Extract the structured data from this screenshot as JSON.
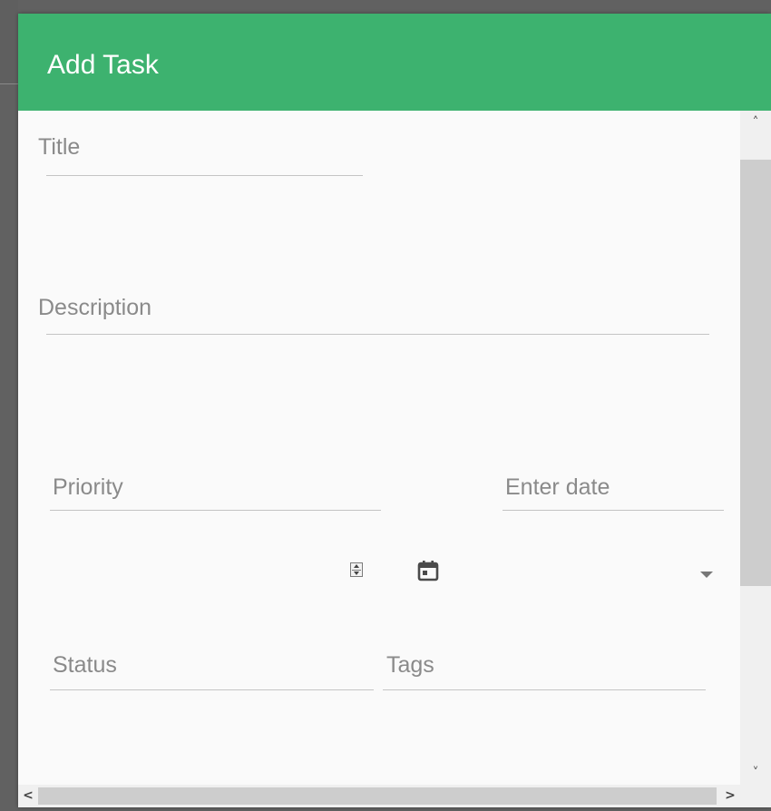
{
  "dialog": {
    "title": "Add Task",
    "header_color": "#3db26f"
  },
  "form": {
    "title_label": "Title",
    "description_label": "Description",
    "priority_label": "Priority",
    "date_placeholder": "Enter date",
    "status_label": "Status",
    "tags_label": "Tags"
  },
  "icons": {
    "spinner": "number-spinner-icon",
    "calendar": "calendar-icon",
    "dropdown": "dropdown-arrow-icon"
  },
  "scrollbars": {
    "up_arrow": "˄",
    "down_arrow": "˅",
    "left_arrow": "<",
    "right_arrow": ">"
  }
}
